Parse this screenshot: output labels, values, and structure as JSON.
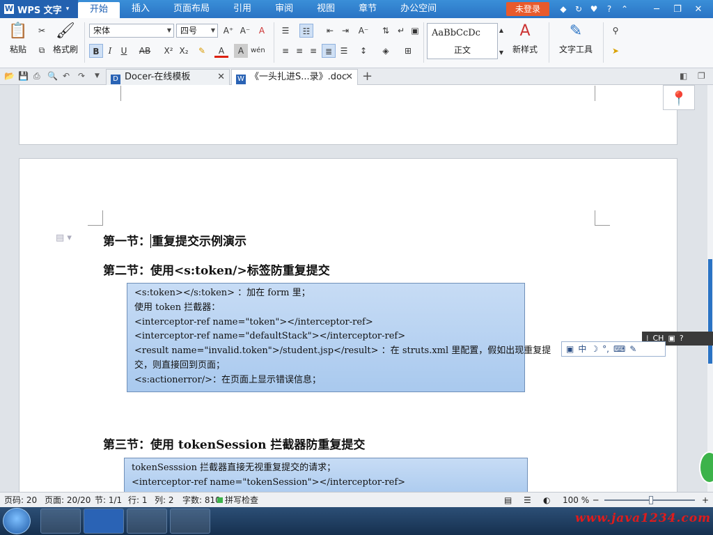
{
  "titlebar": {
    "app_name": "WPS 文字",
    "tabs": [
      "开始",
      "插入",
      "页面布局",
      "引用",
      "审阅",
      "视图",
      "章节",
      "办公空间"
    ],
    "active_tab": "开始",
    "login": "未登录"
  },
  "ribbon": {
    "paste": "粘贴",
    "format_painter": "格式刷",
    "font_name": "宋体",
    "font_size": "四号",
    "style_sample": "AaBbCcDc",
    "style_name": "正文",
    "new_style": "新样式",
    "text_tools": "文字工具"
  },
  "tabs": {
    "docer": "Docer-在线模板",
    "doc": "《一头扎进S...录》.doc"
  },
  "document": {
    "section1": "第一节：重复提交示例演示",
    "section1_prefix": "第一节：",
    "section1_rest": "重复提交示例演示",
    "section2": "第二节：使用<s:token/>标签防重复提交",
    "box1": [
      "<s:token></s:token> ：加在 form 里；",
      "使用 token 拦截器：",
      "<interceptor-ref name=\"token\"></interceptor-ref>",
      "<interceptor-ref name=\"defaultStack\"></interceptor-ref>",
      "<result name=\"invalid.token\">/student.jsp</result>  ：在 struts.xml 里配置，假如出现重复提",
      "交，则直接回到页面；",
      "<s:actionerror/>：在页面上显示错误信息；"
    ],
    "section3": "第三节：使用 tokenSession 拦截器防重复提交",
    "box2": [
      "tokenSesssion 拦截器直接无视重复提交的请求；",
      "<interceptor-ref name=\"tokenSession\"></interceptor-ref>"
    ]
  },
  "ime": {
    "bar": "CH",
    "float": "中"
  },
  "statusbar": {
    "page_num": "页码: 20",
    "pages": "页面: 20/20",
    "section": "节: 1/1",
    "row": "行: 1",
    "col": "列: 2",
    "words": "字数: 810",
    "spell": "拼写检查",
    "zoom": "100 %"
  },
  "watermark": "www.java1234.com"
}
